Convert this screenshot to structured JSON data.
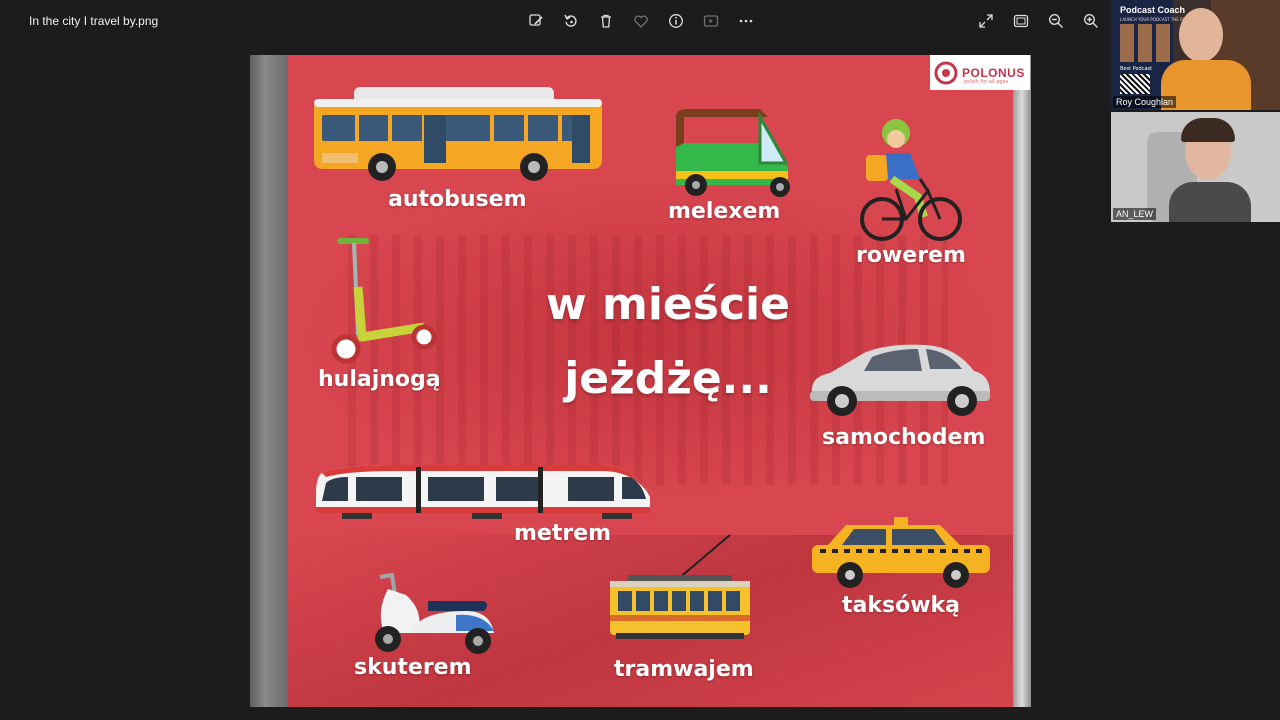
{
  "toolbar": {
    "filename": "In the city I travel by.png",
    "icons": [
      "edit-image-icon",
      "rotate-icon",
      "delete-icon",
      "favorite-icon",
      "info-icon",
      "slideshow-icon",
      "more-icon",
      "fullscreen-icon",
      "fit-window-icon",
      "zoom-out-icon",
      "zoom-in-icon"
    ]
  },
  "poster": {
    "title_line1": "w mieście",
    "title_line2": "jeżdżę...",
    "logo_text": "POLONUS",
    "logo_sub": "polish for all ages",
    "vehicles": {
      "bus": "autobusem",
      "rickshaw": "melexem",
      "bike": "rowerem",
      "scooter_kick": "hulajnogą",
      "car": "samochodem",
      "metro": "metrem",
      "motor_scooter": "skuterem",
      "tram": "tramwajem",
      "taxi": "taksówką"
    },
    "colors": {
      "poster_red": "#d8464f",
      "bus_orange": "#f5a623",
      "taxi_yellow": "#f5b321"
    }
  },
  "participants": [
    {
      "name": "Roy Coughlan",
      "promo_title": "Podcast Coach",
      "promo_sub": "LAUNCH YOUR PODCAST THE RIGHT WAY",
      "promo_best": "Best Podcast"
    },
    {
      "name": "AN_LEW"
    }
  ]
}
